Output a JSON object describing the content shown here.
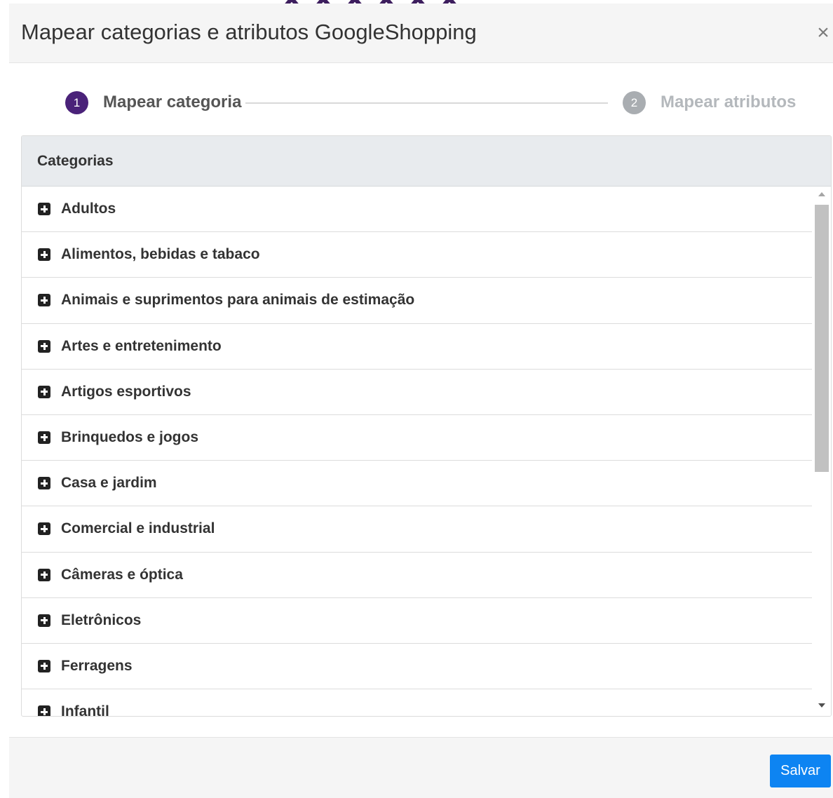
{
  "modal": {
    "title": "Mapear categorias e atributos GoogleShopping",
    "close_symbol": "×"
  },
  "stepper": {
    "steps": [
      {
        "number": "1",
        "label": "Mapear categoria",
        "state": "active",
        "color": "#4a2279"
      },
      {
        "number": "2",
        "label": "Mapear atributos",
        "state": "inactive",
        "color": "#a9adb1"
      }
    ]
  },
  "panel": {
    "header": "Categorias",
    "expand_icon": "plus-square-icon",
    "categories": [
      "Adultos",
      "Alimentos, bebidas e tabaco",
      "Animais e suprimentos para animais de estimação",
      "Artes e entretenimento",
      "Artigos esportivos",
      "Brinquedos e jogos",
      "Casa e jardim",
      "Comercial e industrial",
      "Câmeras e óptica",
      "Eletrônicos",
      "Ferragens",
      "Infantil"
    ]
  },
  "footer": {
    "save_label": "Salvar",
    "save_color": "#0d84f2"
  }
}
